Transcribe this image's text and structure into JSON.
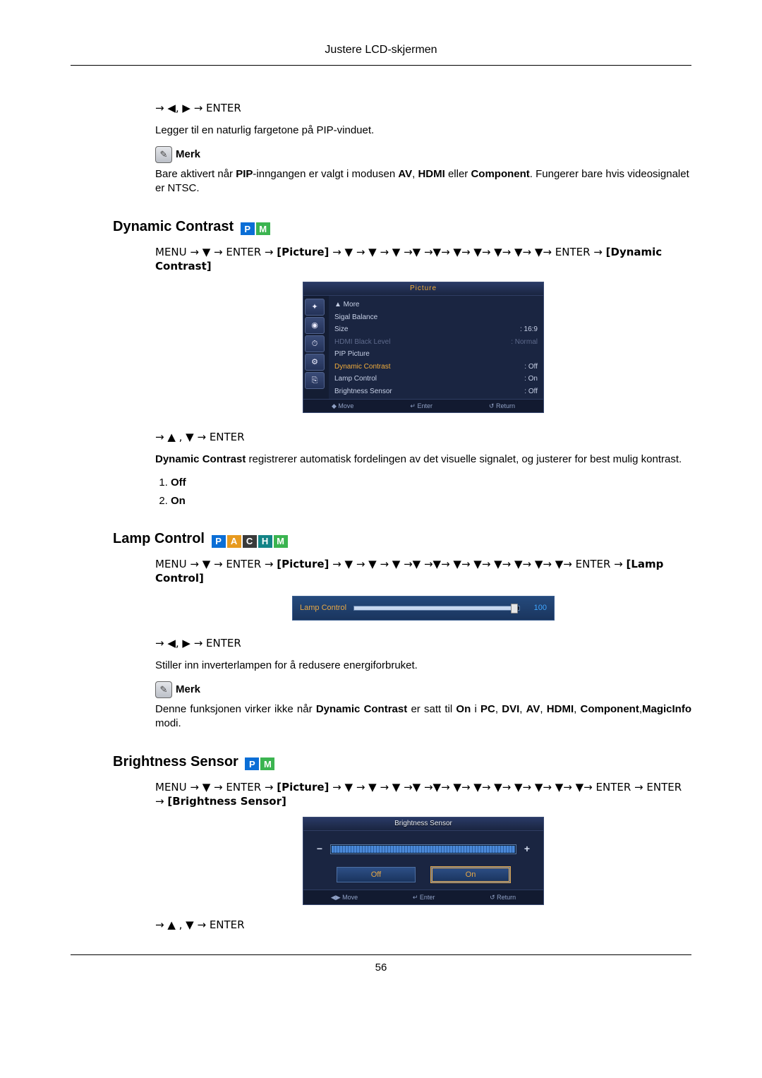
{
  "header": {
    "title": "Justere LCD-skjermen"
  },
  "intro": {
    "nav": "→ ◀, ▶ → ENTER",
    "desc": "Legger til en naturlig fargetone på PIP-vinduet.",
    "note_label": "Merk",
    "note_text_1": "Bare aktivert når ",
    "note_text_2": "-inngangen er valgt i modusen ",
    "note_text_3": " eller ",
    "note_text_4": ". Fungerer bare hvis videosignalet er NTSC.",
    "pip": "PIP",
    "av": "AV",
    "hdmi": "HDMI",
    "comp": "Component"
  },
  "dyn": {
    "heading": "Dynamic Contrast",
    "menu_path_pre": "MENU → ▼ → ENTER → ",
    "picture_lbl": "[Picture]",
    "menu_path_post": " → ▼ → ▼ → ▼ →▼ →▼→ ▼→ ▼→ ▼→ ▼→ ▼→ ENTER → ",
    "dc_lbl": "[Dynamic Contrast]",
    "nav2": "→ ▲ , ▼ → ENTER",
    "desc_a": "Dynamic Contrast",
    "desc_b": "  registrerer automatisk fordelingen av det visuelle signalet, og justerer for best mulig kontrast.",
    "opt1": "Off",
    "opt2": "On"
  },
  "osd": {
    "title": "Picture",
    "more": "▲ More",
    "r1_lbl": "Sigal Balance",
    "r2_lbl": "Size",
    "r2_val": "16:9",
    "r3_lbl": "HDMI Black Level",
    "r3_val": "Normal",
    "r4_lbl": "PIP Picture",
    "r5_lbl": "Dynamic Contrast",
    "r5_val": "Off",
    "r6_lbl": "Lamp Control",
    "r6_val": "On",
    "r7_lbl": "Brightness Sensor",
    "r7_val": "Off",
    "f_move": "Move",
    "f_enter": "Enter",
    "f_return": "Return"
  },
  "lamp": {
    "heading": "Lamp Control",
    "menu_path_pre": "MENU → ▼ → ENTER → ",
    "picture_lbl": "[Picture]",
    "menu_path_post": " → ▼ → ▼ → ▼ →▼ →▼→ ▼→ ▼→ ▼→ ▼→ ▼→ ▼→ ENTER → ",
    "lc_lbl": "[Lamp Control]",
    "slider_label": "Lamp Control",
    "slider_value": "100",
    "nav2": "→ ◀, ▶ → ENTER",
    "desc": "Stiller inn inverterlampen for å redusere energiforbruket.",
    "note_label": "Merk",
    "note2a": "Denne  funksjonen  virker  ikke  når  ",
    "note2b": "Dynamic  Contrast",
    "note2c": "  er  satt  til  ",
    "note2d": "On",
    "note2e": "  i  ",
    "note2f": "PC",
    "note2g": ",  ",
    "note2h": "DVI",
    "note2i": ",  ",
    "note2j": "AV",
    "note2k": ",  ",
    "note2l": "HDMI",
    "note2m": ", ",
    "note2n": "Component",
    "note2o": ",",
    "note2p": "MagicInfo",
    "note2q": " modi."
  },
  "bs": {
    "heading": "Brightness Sensor",
    "menu_path_pre": "MENU → ▼ → ENTER → ",
    "picture_lbl": "[Picture]",
    "menu_path_post": " → ▼ → ▼ → ▼ →▼ →▼→ ▼→ ▼→ ▼→ ▼→ ▼→ ▼→ ▼→ ENTER → ",
    "bs_lbl": "[Brightness Sensor]",
    "box_title": "Brightness Sensor",
    "off": "Off",
    "on": "On",
    "f_move": "Move",
    "f_enter": "Enter",
    "f_return": "Return",
    "nav2": "→ ▲ , ▼ → ENTER"
  },
  "footer": {
    "page": "56"
  }
}
